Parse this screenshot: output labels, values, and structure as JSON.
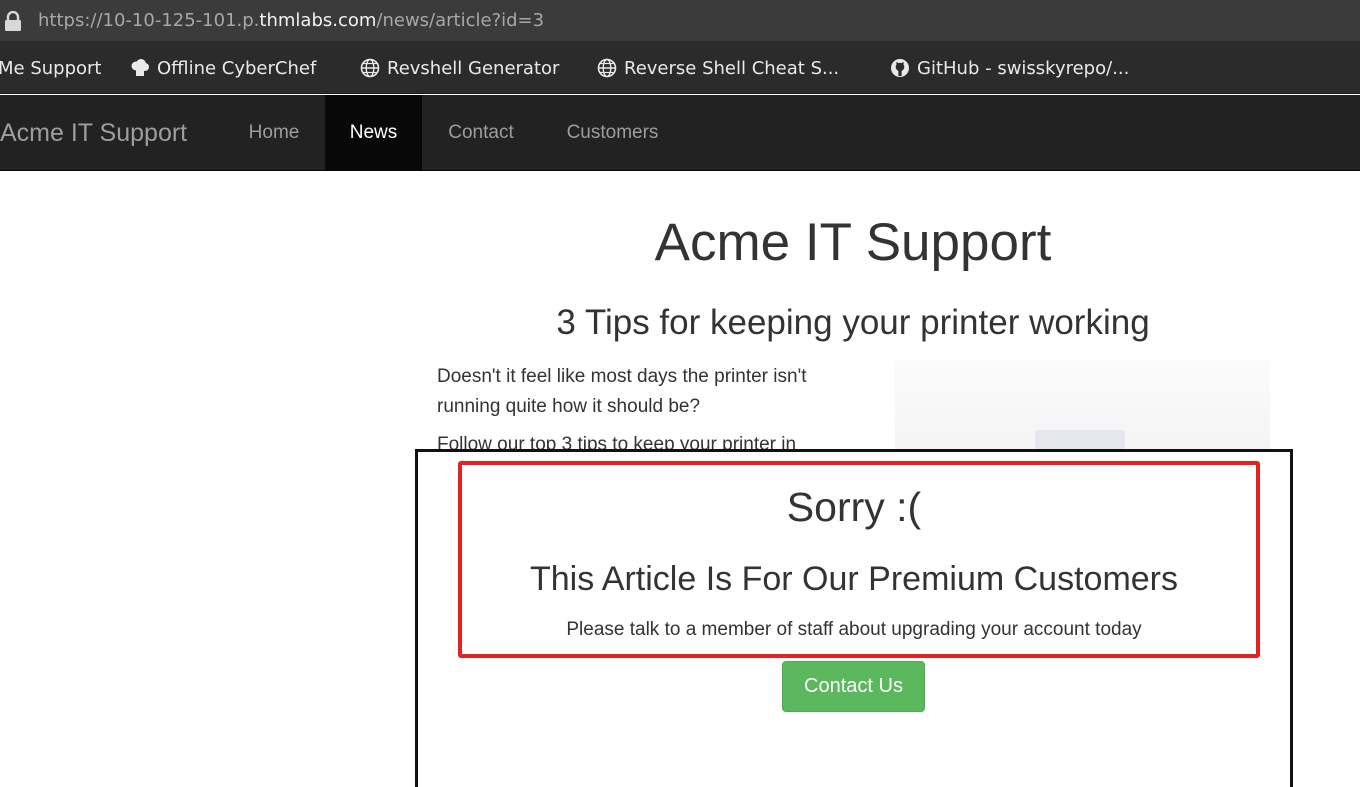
{
  "browser": {
    "url_prefix": "https://10-10-125-101.p.",
    "url_host": "thmlabs.com",
    "url_path": "/news/article?id=3",
    "bookmarks": [
      {
        "label": "Me Support",
        "icon": "none"
      },
      {
        "label": "Offline CyberChef",
        "icon": "chef-hat-icon"
      },
      {
        "label": "Revshell Generator",
        "icon": "globe-icon"
      },
      {
        "label": "Reverse Shell Cheat S...",
        "icon": "globe-icon"
      },
      {
        "label": "GitHub - swisskyrepo/...",
        "icon": "github-icon"
      }
    ]
  },
  "navbar": {
    "brand": "Acme IT Support",
    "items": [
      {
        "label": "Home",
        "active": false
      },
      {
        "label": "News",
        "active": true
      },
      {
        "label": "Contact",
        "active": false
      },
      {
        "label": "Customers",
        "active": false
      }
    ]
  },
  "page": {
    "site_title": "Acme IT Support",
    "article_title": "3 Tips for keeping your printer working",
    "paragraphs": [
      "Doesn't it feel like most days the printer isn't running quite how it should be?",
      "Follow our top 3 tips to keep your printer in"
    ]
  },
  "paywall": {
    "heading": "Sorry :(",
    "subheading": "This Article Is For Our Premium Customers",
    "message": "Please talk to a member of staff about upgrading your account today",
    "button_label": "Contact Us"
  },
  "colors": {
    "navbar_bg": "#222222",
    "nav_active_bg": "#080808",
    "button_green": "#5cb85c",
    "highlight_red": "#e52222"
  }
}
